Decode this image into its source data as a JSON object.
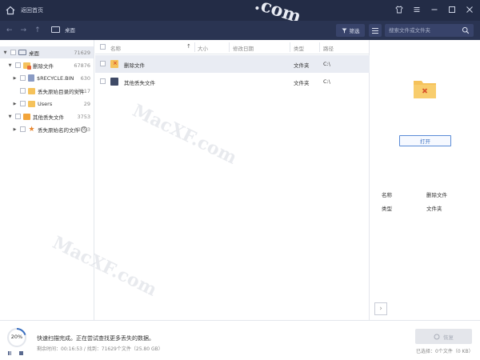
{
  "titlebar": {
    "back_label": "返回首页"
  },
  "toolbar": {
    "location": "桌面",
    "filter_label": "筛选",
    "search_placeholder": "搜索文件或文件夹"
  },
  "tree": [
    {
      "label": "桌面",
      "count": "71629"
    },
    {
      "label": "删除文件",
      "count": "67876"
    },
    {
      "label": "$RECYCLE.BIN",
      "count": "630"
    },
    {
      "label": "丢失原始目录的文件",
      "count": "67217"
    },
    {
      "label": "Users",
      "count": "29"
    },
    {
      "label": "其他丢失文件",
      "count": "3753"
    },
    {
      "label": "丢失原始名的文件",
      "count": "3753",
      "help": "?"
    }
  ],
  "file_list": {
    "headers": {
      "name": "名称",
      "size": "大小",
      "modified": "修改日期",
      "type": "类型",
      "path": "路径"
    },
    "rows": [
      {
        "name": "删除文件",
        "type": "文件夹",
        "path": "C:\\"
      },
      {
        "name": "其他丢失文件",
        "type": "文件夹",
        "path": "C:\\"
      }
    ]
  },
  "preview": {
    "open_label": "打开",
    "name_key": "名称",
    "name_val": "删除文件",
    "type_key": "类型",
    "type_val": "文件夹"
  },
  "status": {
    "progress_percent": 20,
    "progress_label": "20%",
    "message": "快速扫描完成。正在尝试查找更多丢失的数据。",
    "detail": "剩余时间：00:16:53 / 找到：71629个文件（25.80 GB）",
    "recover_label": "恢复",
    "selected_info": "已选择：0个文件（0 KB）"
  },
  "watermark": {
    "text": "MacXF.com",
    "top_text": ".com"
  },
  "colors": {
    "titlebar": "#232c46",
    "toolbar": "#2a3452",
    "accent": "#3a6fc0",
    "folder": "#f5c25b"
  }
}
